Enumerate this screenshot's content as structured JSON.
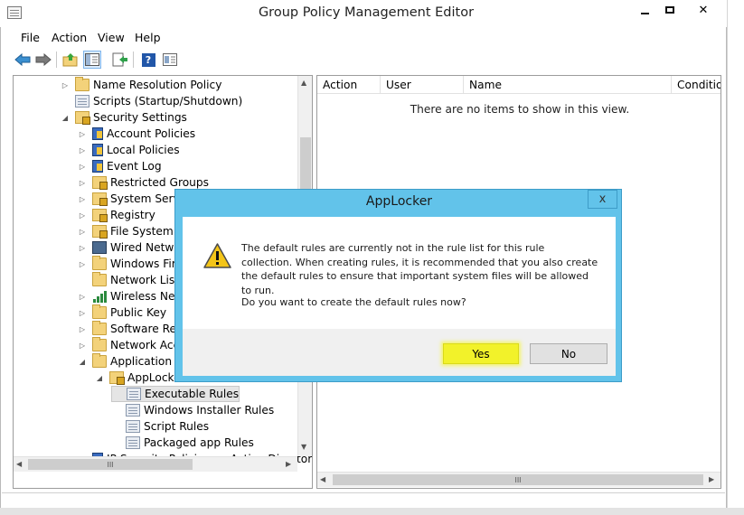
{
  "window": {
    "title": "Group Policy Management Editor",
    "controls": {
      "minimize": "—",
      "maximize": "□",
      "close": "✕"
    }
  },
  "menu": [
    "File",
    "Action",
    "View",
    "Help"
  ],
  "toolbar": {
    "icons": [
      "back-arrow-icon",
      "forward-arrow-icon",
      "up-folder-icon",
      "show-hide-tree-icon",
      "export-list-icon",
      "help-icon",
      "properties-icon"
    ],
    "help_glyph": "?"
  },
  "tree": {
    "items": [
      {
        "label": "Name Resolution Policy",
        "arrow": "▷"
      },
      {
        "label": "Scripts (Startup/Shutdown)",
        "arrow": ""
      },
      {
        "label": "Security Settings",
        "arrow": "◢"
      },
      {
        "label": "Account Policies",
        "arrow": "▷"
      },
      {
        "label": "Local Policies",
        "arrow": "▷"
      },
      {
        "label": "Event Log",
        "arrow": "▷"
      },
      {
        "label": "Restricted Groups",
        "arrow": "▷"
      },
      {
        "label": "System Services",
        "arrow": "▷"
      },
      {
        "label": "Registry",
        "arrow": "▷"
      },
      {
        "label": "File System",
        "arrow": "▷"
      },
      {
        "label": "Wired Network",
        "arrow": "▷"
      },
      {
        "label": "Windows Firewall",
        "arrow": "▷"
      },
      {
        "label": "Network List",
        "arrow": ""
      },
      {
        "label": "Wireless Network",
        "arrow": "▷"
      },
      {
        "label": "Public Key",
        "arrow": "▷"
      },
      {
        "label": "Software Restriction",
        "arrow": "▷"
      },
      {
        "label": "Network Access",
        "arrow": "▷"
      },
      {
        "label": "Application",
        "arrow": "◢"
      },
      {
        "label": "AppLocker",
        "arrow": "◢"
      },
      {
        "label": "Executable Rules",
        "arrow": ""
      },
      {
        "label": "Windows Installer Rules",
        "arrow": ""
      },
      {
        "label": "Script Rules",
        "arrow": ""
      },
      {
        "label": "Packaged app Rules",
        "arrow": ""
      },
      {
        "label": "IP Security Policies on Active Directory",
        "arrow": "▷"
      }
    ],
    "scroll_grip": "III"
  },
  "list": {
    "columns": [
      "Action",
      "User",
      "Name",
      "Condition"
    ],
    "empty_message": "There are no items to show in this view.",
    "scroll_grip": "III"
  },
  "dialog": {
    "title": "AppLocker",
    "close": "x",
    "message": "The default rules are currently not in the rule list for this rule collection. When creating rules, it is recommended that you also create the default rules to ensure that important system files will be allowed to run.",
    "question": "Do you want to create the default rules now?",
    "yes": "Yes",
    "no": "No",
    "highlight": "#f2f22a",
    "title_color": "#62c3ea"
  }
}
